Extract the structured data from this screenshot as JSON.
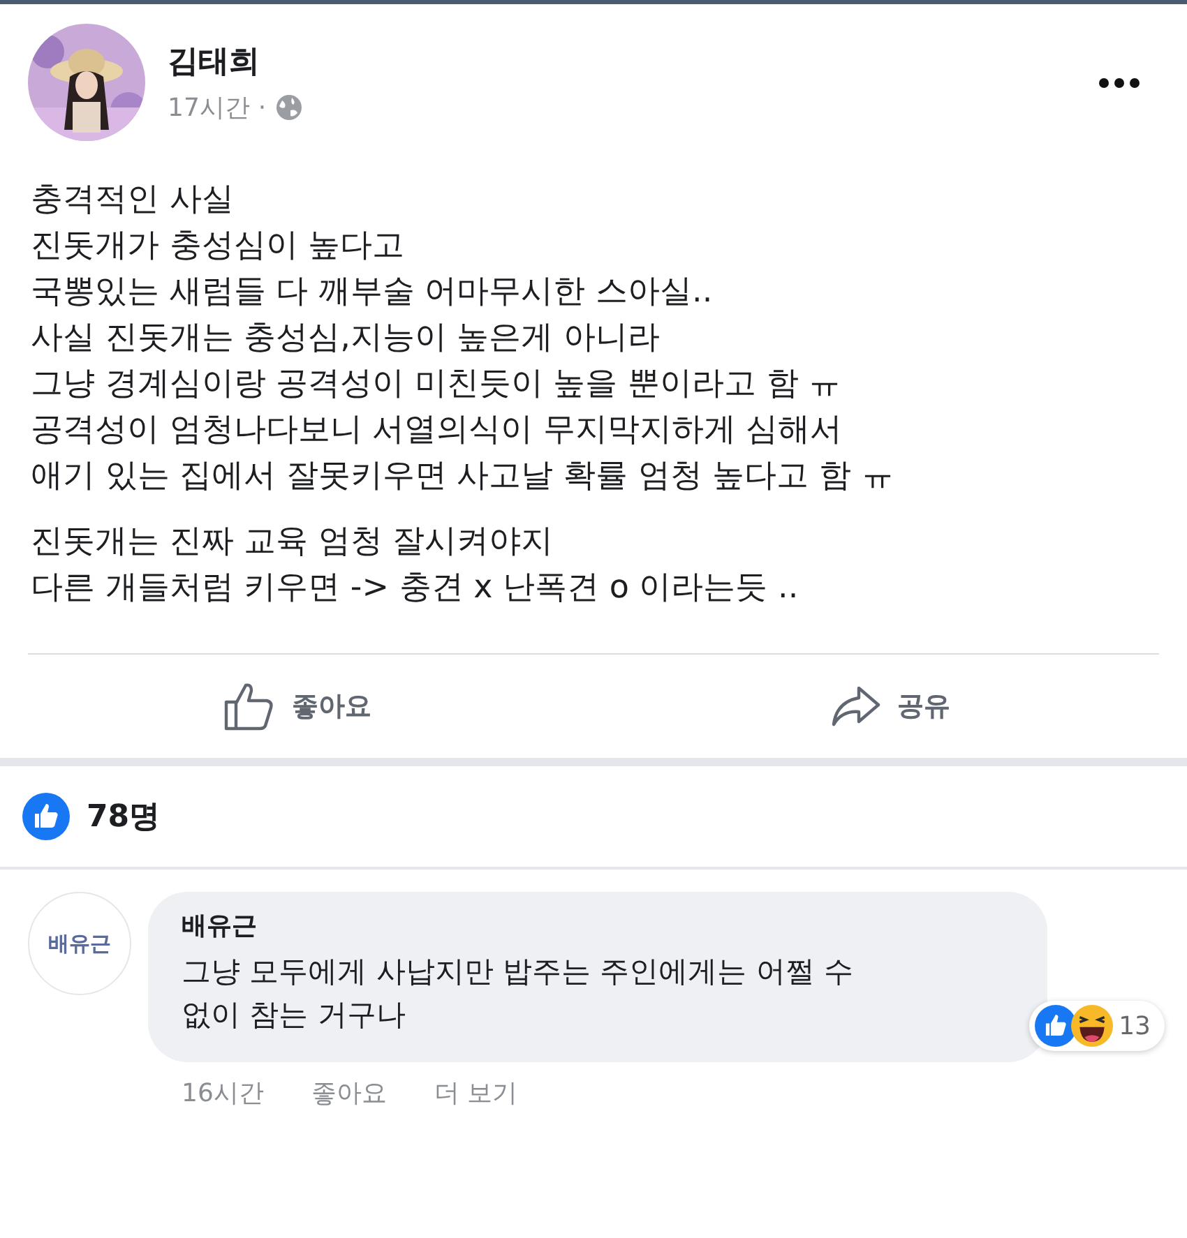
{
  "post": {
    "author": "김태희",
    "time": "17시간",
    "separator": "·",
    "paragraphs": [
      "충격적인 사실\n진돗개가 충성심이 높다고\n국뽕있는 새럼들 다 깨부술 어마무시한 스아실..\n사실 진돗개는 충성심,지능이 높은게 아니라\n그냥 경계심이랑 공격성이 미친듯이 높을 뿐이라고 함 ㅠ\n공격성이 엄청나다보니 서열의식이 무지막지하게 심해서\n애기 있는 집에서 잘못키우면 사고날 확률 엄청 높다고 함 ㅠ",
      "진돗개는 진짜 교육 엄청 잘시켜야지\n다른 개들처럼 키우면 -> 충견 x 난폭견 o 이라는듯 .."
    ],
    "actions": [
      "좋아요",
      "공유"
    ],
    "like_count": "78명"
  },
  "comment": {
    "avatar_text": "배유근",
    "author": "배유근",
    "text": "그냥 모두에게 사납지만 밥주는 주인에게는 어쩔 수 없이 참는 거구나",
    "reaction_count": "13",
    "time": "16시간",
    "actions": [
      "좋아요",
      "더 보기"
    ]
  }
}
